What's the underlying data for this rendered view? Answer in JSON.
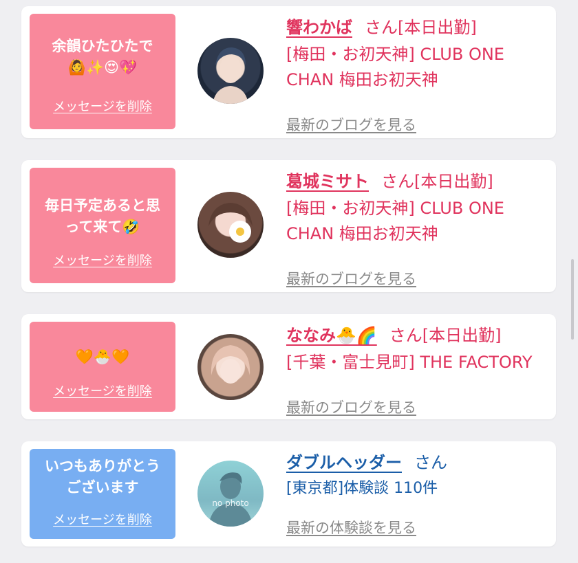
{
  "cards": [
    {
      "message_line1": "余韻ひたひたで",
      "message_line2": "🙆✨😍💖",
      "delete_label": "メッセージを削除",
      "name": "響わかば",
      "honorific": "さん",
      "status": "[本日出勤]",
      "shop_line1": "[梅田・お初天神] CLUB ONE",
      "shop_line2": "CHAN 梅田お初天神",
      "link_label": "最新のブログを見る"
    },
    {
      "message_line1": "毎日予定あると思",
      "message_line2": "って来て🤣",
      "delete_label": "メッセージを削除",
      "name": "葛城ミサト",
      "honorific": "さん",
      "status": "[本日出勤]",
      "shop_line1": "[梅田・お初天神] CLUB ONE",
      "shop_line2": "CHAN 梅田お初天神",
      "link_label": "最新のブログを見る"
    },
    {
      "message_line1": "🧡🐣🧡",
      "delete_label": "メッセージを削除",
      "name": "ななみ🐣🌈",
      "honorific": "さん",
      "status": "[本日出勤]",
      "shop_line1": "[千葉・富士見町] THE FACTORY",
      "link_label": "最新のブログを見る"
    },
    {
      "message_line1": "いつもありがとう",
      "message_line2": "ございます",
      "delete_label": "メッセージを削除",
      "name": "ダブルヘッダー",
      "honorific": "さん",
      "shop_line1": "[東京都]体験談 110件",
      "avatar_text": "no photo",
      "link_label": "最新の体験談を見る"
    }
  ],
  "colors": {
    "pink_bubble": "#f9889b",
    "blue_bubble": "#78aef2",
    "pink_text": "#e0335d",
    "blue_text": "#1b5ea8",
    "link_gray": "#8a8a8a"
  }
}
